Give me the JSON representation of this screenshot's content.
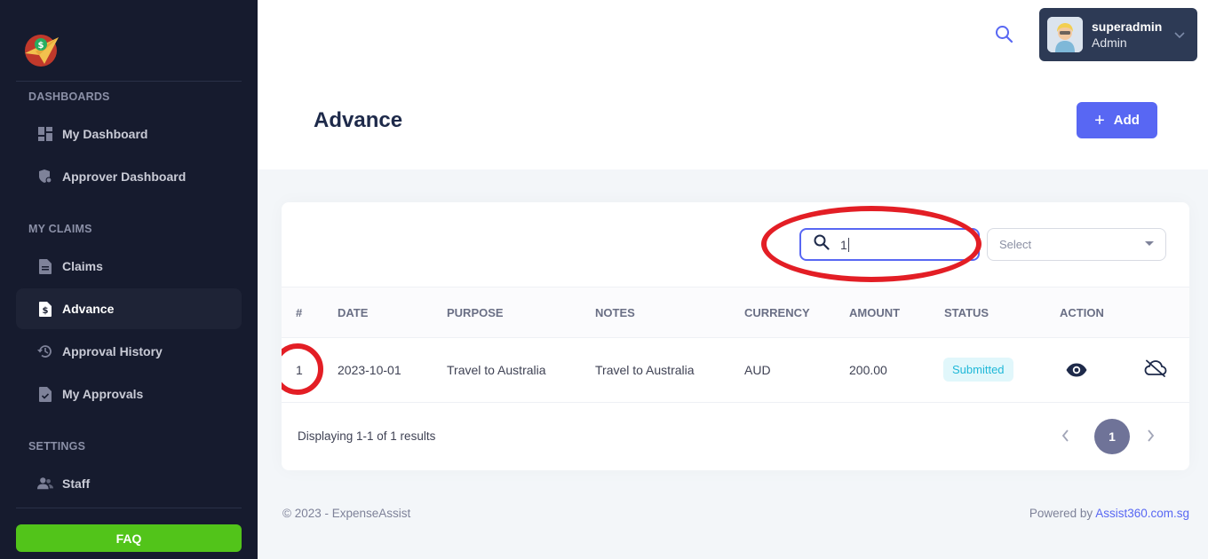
{
  "sidebar": {
    "sections": [
      {
        "title": "DASHBOARDS"
      },
      {
        "title": "MY CLAIMS"
      },
      {
        "title": "SETTINGS"
      }
    ],
    "items": [
      {
        "label": "My Dashboard",
        "icon": "grid-icon"
      },
      {
        "label": "Approver Dashboard",
        "icon": "shield-gear-icon"
      },
      {
        "label": "Claims",
        "icon": "document-icon"
      },
      {
        "label": "Advance",
        "icon": "dollar-document-icon",
        "active": true
      },
      {
        "label": "Approval History",
        "icon": "history-icon"
      },
      {
        "label": "My Approvals",
        "icon": "check-document-icon"
      },
      {
        "label": "Staff",
        "icon": "people-icon"
      }
    ],
    "faq_label": "FAQ"
  },
  "header": {
    "user_name": "superadmin",
    "user_role": "Admin"
  },
  "page": {
    "title": "Advance",
    "add_label": "Add"
  },
  "filters": {
    "search_value": "1",
    "select_placeholder": "Select"
  },
  "table": {
    "columns": [
      "#",
      "DATE",
      "PURPOSE",
      "NOTES",
      "CURRENCY",
      "AMOUNT",
      "STATUS",
      "ACTION"
    ],
    "rows": [
      {
        "num": "1",
        "date": "2023-10-01",
        "purpose": "Travel to Australia",
        "notes": "Travel to Australia",
        "currency": "AUD",
        "amount": "200.00",
        "status": "Submitted"
      }
    ],
    "summary": "Displaying 1-1 of 1 results",
    "current_page": "1"
  },
  "footer": {
    "copyright": "© 2023 - ExpenseAssist",
    "powered_prefix": "Powered by",
    "powered_link": "Assist360.com.sg"
  },
  "colors": {
    "sidebar_bg": "#161b2e",
    "accent": "#5867f3",
    "faq_green": "#52c41a",
    "annotation_red": "#e31e25",
    "status_text": "#1fb8d8"
  }
}
